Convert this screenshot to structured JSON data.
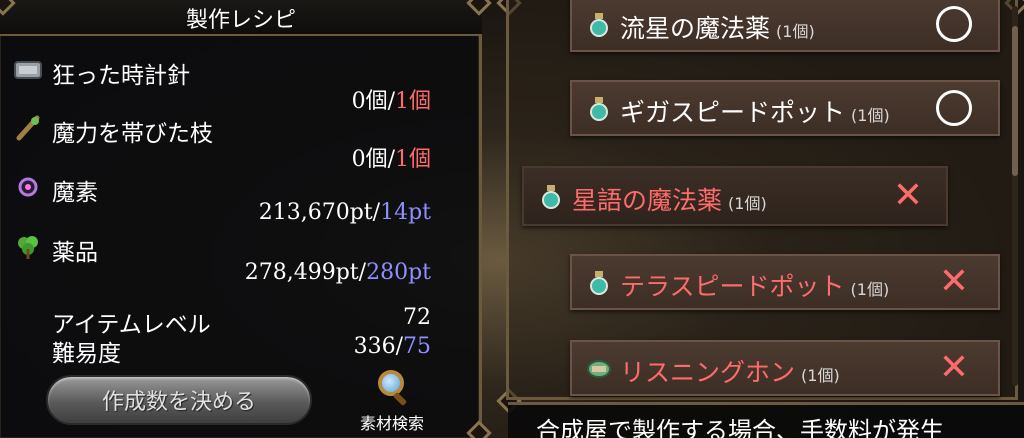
{
  "recipe_panel": {
    "title": "製作レシピ",
    "materials": [
      {
        "name": "狂った時計針",
        "have": "0個",
        "sep": "/",
        "need": "1個",
        "icon": "clock-hand-icon"
      },
      {
        "name": "魔力を帯びた枝",
        "have": "0個",
        "sep": "/",
        "need": "1個",
        "icon": "branch-icon"
      },
      {
        "name": "魔素",
        "have": "213,670pt",
        "sep": "/",
        "need": "14pt",
        "icon": "mana-orb-icon"
      },
      {
        "name": "薬品",
        "have": "278,499pt",
        "sep": "/",
        "need": "280pt",
        "icon": "herb-icon"
      }
    ],
    "stats": {
      "item_level_label": "アイテムレベル",
      "item_level_value": "72",
      "difficulty_label": "難易度",
      "difficulty_value": "336",
      "difficulty_sep": "/",
      "difficulty_max": "75"
    },
    "decide_button": "作成数を決める",
    "search_button": "素材検索"
  },
  "recipe_list": [
    {
      "name": "流星の魔法薬",
      "count": "(1個)",
      "status": "○",
      "craftable": true,
      "icon": "potion-icon"
    },
    {
      "name": "ギガスピードポット",
      "count": "(1個)",
      "status": "○",
      "craftable": true,
      "icon": "potion-icon"
    },
    {
      "name": "星語の魔法薬",
      "count": "(1個)",
      "status": "✕",
      "craftable": false,
      "icon": "potion-icon"
    },
    {
      "name": "テラスピードポット",
      "count": "(1個)",
      "status": "✕",
      "craftable": false,
      "icon": "potion-icon"
    },
    {
      "name": "リスニングホン",
      "count": "(1個)",
      "status": "✕",
      "craftable": false,
      "icon": "horn-icon"
    }
  ],
  "bottom_message": "合成屋で製作する場合、手数料が発生",
  "colors": {
    "shortage": "#ff6b6b",
    "requirement": "#8f8fff",
    "frame": "#6b5a3d"
  }
}
